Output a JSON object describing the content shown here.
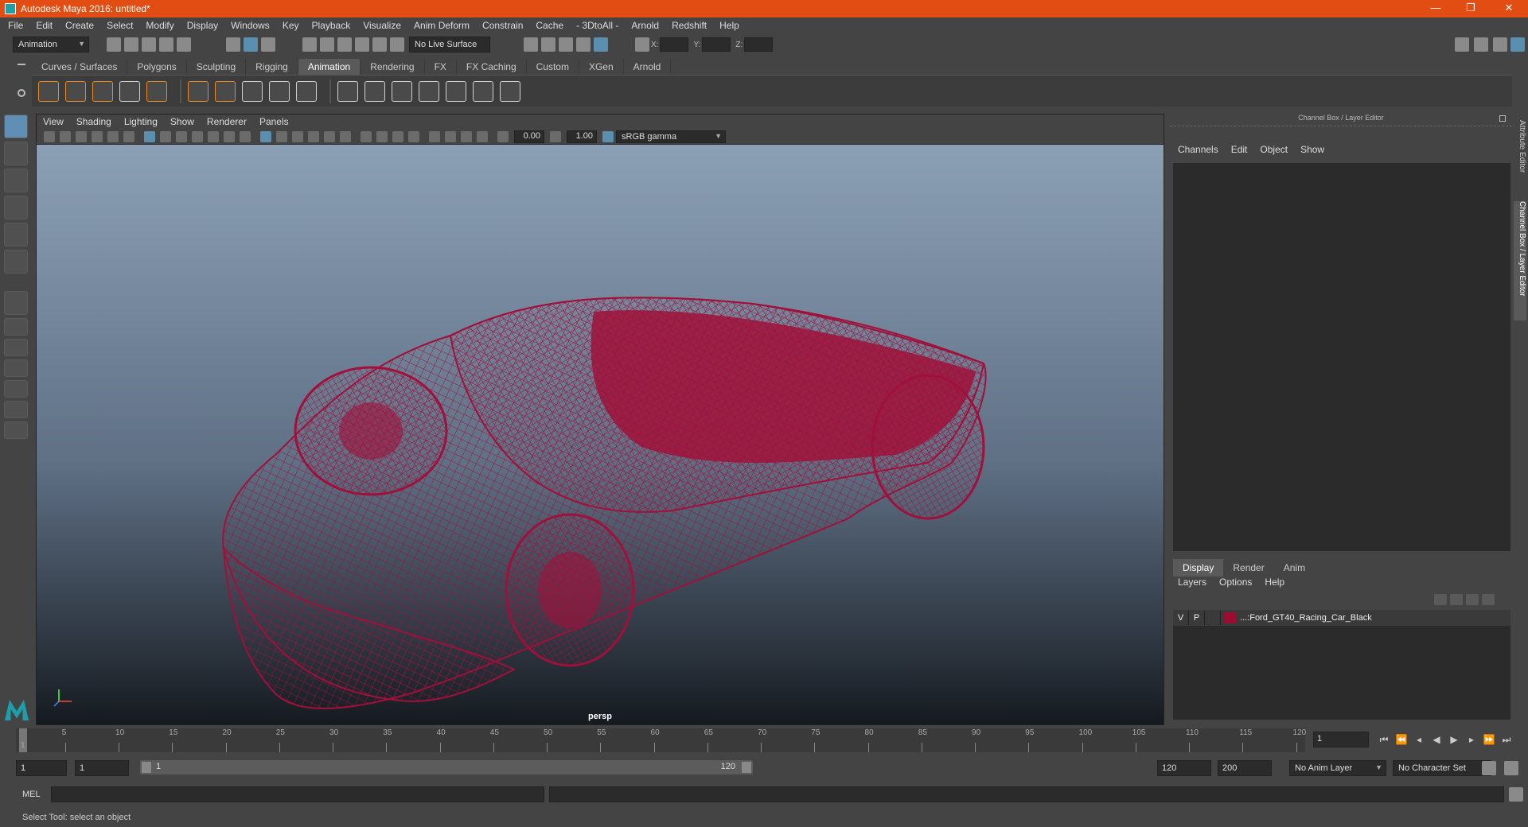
{
  "window": {
    "title": "Autodesk Maya 2016: untitled*",
    "minimize": "—",
    "maximize": "❐",
    "close": "✕"
  },
  "menubar": [
    "File",
    "Edit",
    "Create",
    "Select",
    "Modify",
    "Display",
    "Windows",
    "Key",
    "Playback",
    "Visualize",
    "Anim Deform",
    "Constrain",
    "Cache",
    "- 3DtoAll -",
    "Arnold",
    "Redshift",
    "Help"
  ],
  "statusline": {
    "mode": "Animation",
    "live_surface": "No Live Surface",
    "x_label": "X:",
    "y_label": "Y:",
    "z_label": "Z:"
  },
  "shelf_tabs": [
    "Curves / Surfaces",
    "Polygons",
    "Sculpting",
    "Rigging",
    "Animation",
    "Rendering",
    "FX",
    "FX Caching",
    "Custom",
    "XGen",
    "Arnold"
  ],
  "shelf_active": "Animation",
  "viewport": {
    "menu": [
      "View",
      "Shading",
      "Lighting",
      "Show",
      "Renderer",
      "Panels"
    ],
    "exposure": "0.00",
    "gamma": "1.00",
    "color_space": "sRGB gamma",
    "camera_label": "persp",
    "wire_color": "#a0103a"
  },
  "channel_box": {
    "header": "Channel Box / Layer Editor",
    "menu": [
      "Channels",
      "Edit",
      "Object",
      "Show"
    ],
    "layer_tabs": [
      "Display",
      "Render",
      "Anim"
    ],
    "layer_tab_active": "Display",
    "layer_menu": [
      "Layers",
      "Options",
      "Help"
    ],
    "layers": [
      {
        "visible": "V",
        "playback": "P",
        "name": "...:Ford_GT40_Racing_Car_Black",
        "color": "#9a0d30"
      }
    ],
    "side_tabs": [
      "Attribute Editor",
      "Channel Box / Layer Editor"
    ]
  },
  "timeline": {
    "ticks": [
      5,
      10,
      15,
      20,
      25,
      30,
      35,
      40,
      45,
      50,
      55,
      60,
      65,
      70,
      75,
      80,
      85,
      90,
      95,
      100,
      105,
      110,
      115,
      120
    ],
    "start_label": "1",
    "current_frame": "1"
  },
  "range": {
    "start": "1",
    "playback_start": "1",
    "slider_start": "1",
    "slider_end": "120",
    "playback_end": "120",
    "end": "200",
    "anim_layer": "No Anim Layer",
    "character_set": "No Character Set"
  },
  "command": {
    "label": "MEL"
  },
  "help_line": "Select Tool: select an object"
}
